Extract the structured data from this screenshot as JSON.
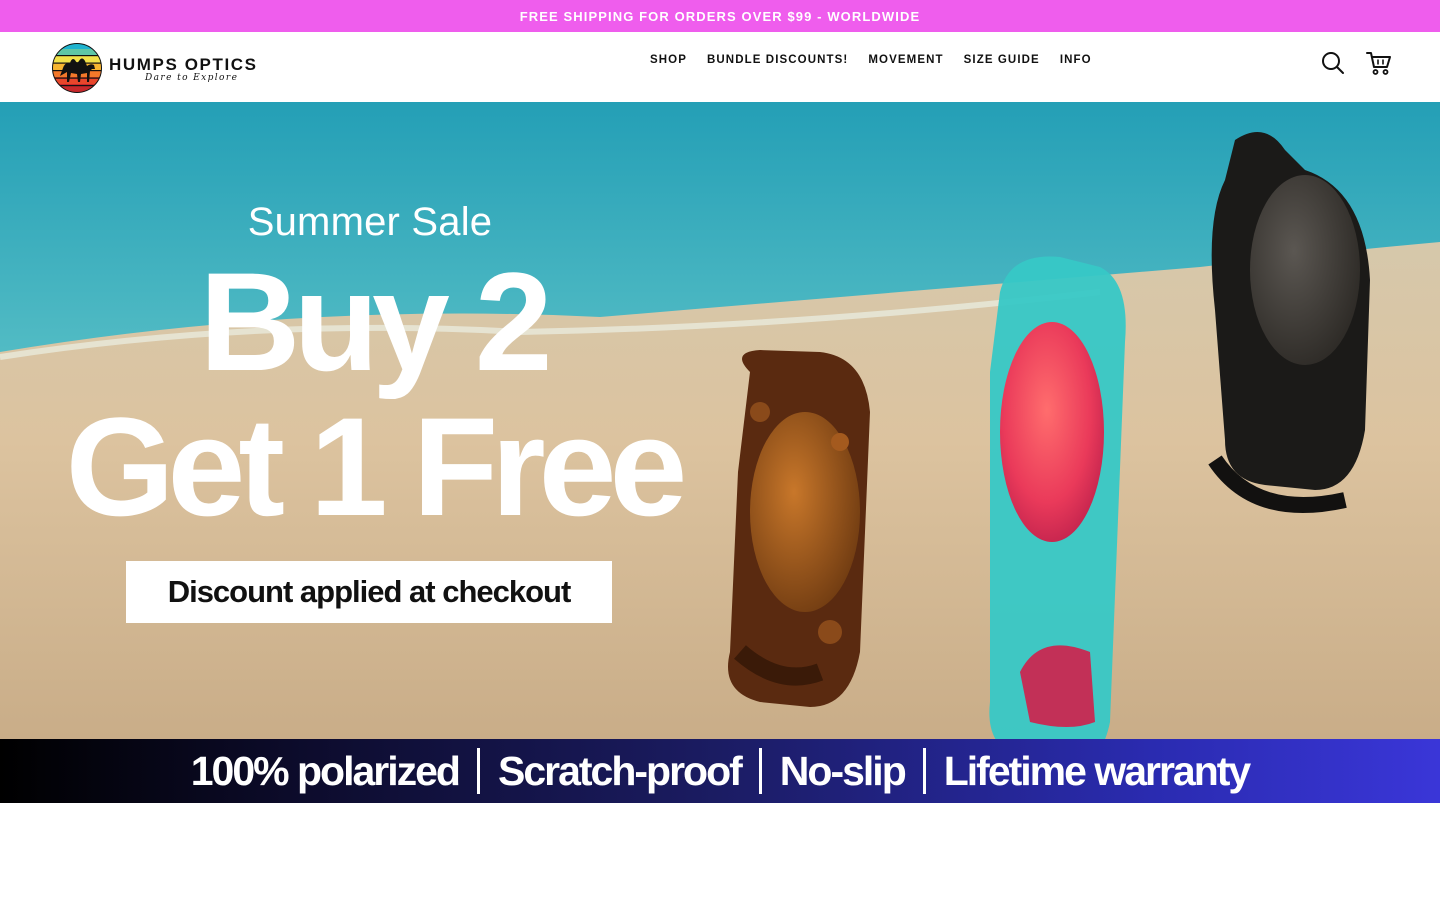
{
  "announcement": {
    "text": "FREE SHIPPING FOR ORDERS OVER $99 - WORLDWIDE"
  },
  "header": {
    "brand": "HUMPS OPTICS",
    "tagline": "Dare to Explore",
    "nav": [
      "SHOP",
      "BUNDLE DISCOUNTS!",
      "MOVEMENT",
      "SIZE GUIDE",
      "INFO"
    ],
    "icons": {
      "search": "search-icon",
      "cart": "cart-icon"
    }
  },
  "hero": {
    "eyebrow": "Summer Sale",
    "headline_line1": "Buy 2",
    "headline_line2": "Get 1 Free",
    "button_text": "Discount applied at checkout"
  },
  "features": [
    "100% polarized",
    "Scratch-proof",
    "No-slip",
    "Lifetime warranty"
  ],
  "colors": {
    "announcement_bg": "#ef5ded",
    "features_gradient_start": "#000000",
    "features_gradient_end": "#3a36d8"
  }
}
